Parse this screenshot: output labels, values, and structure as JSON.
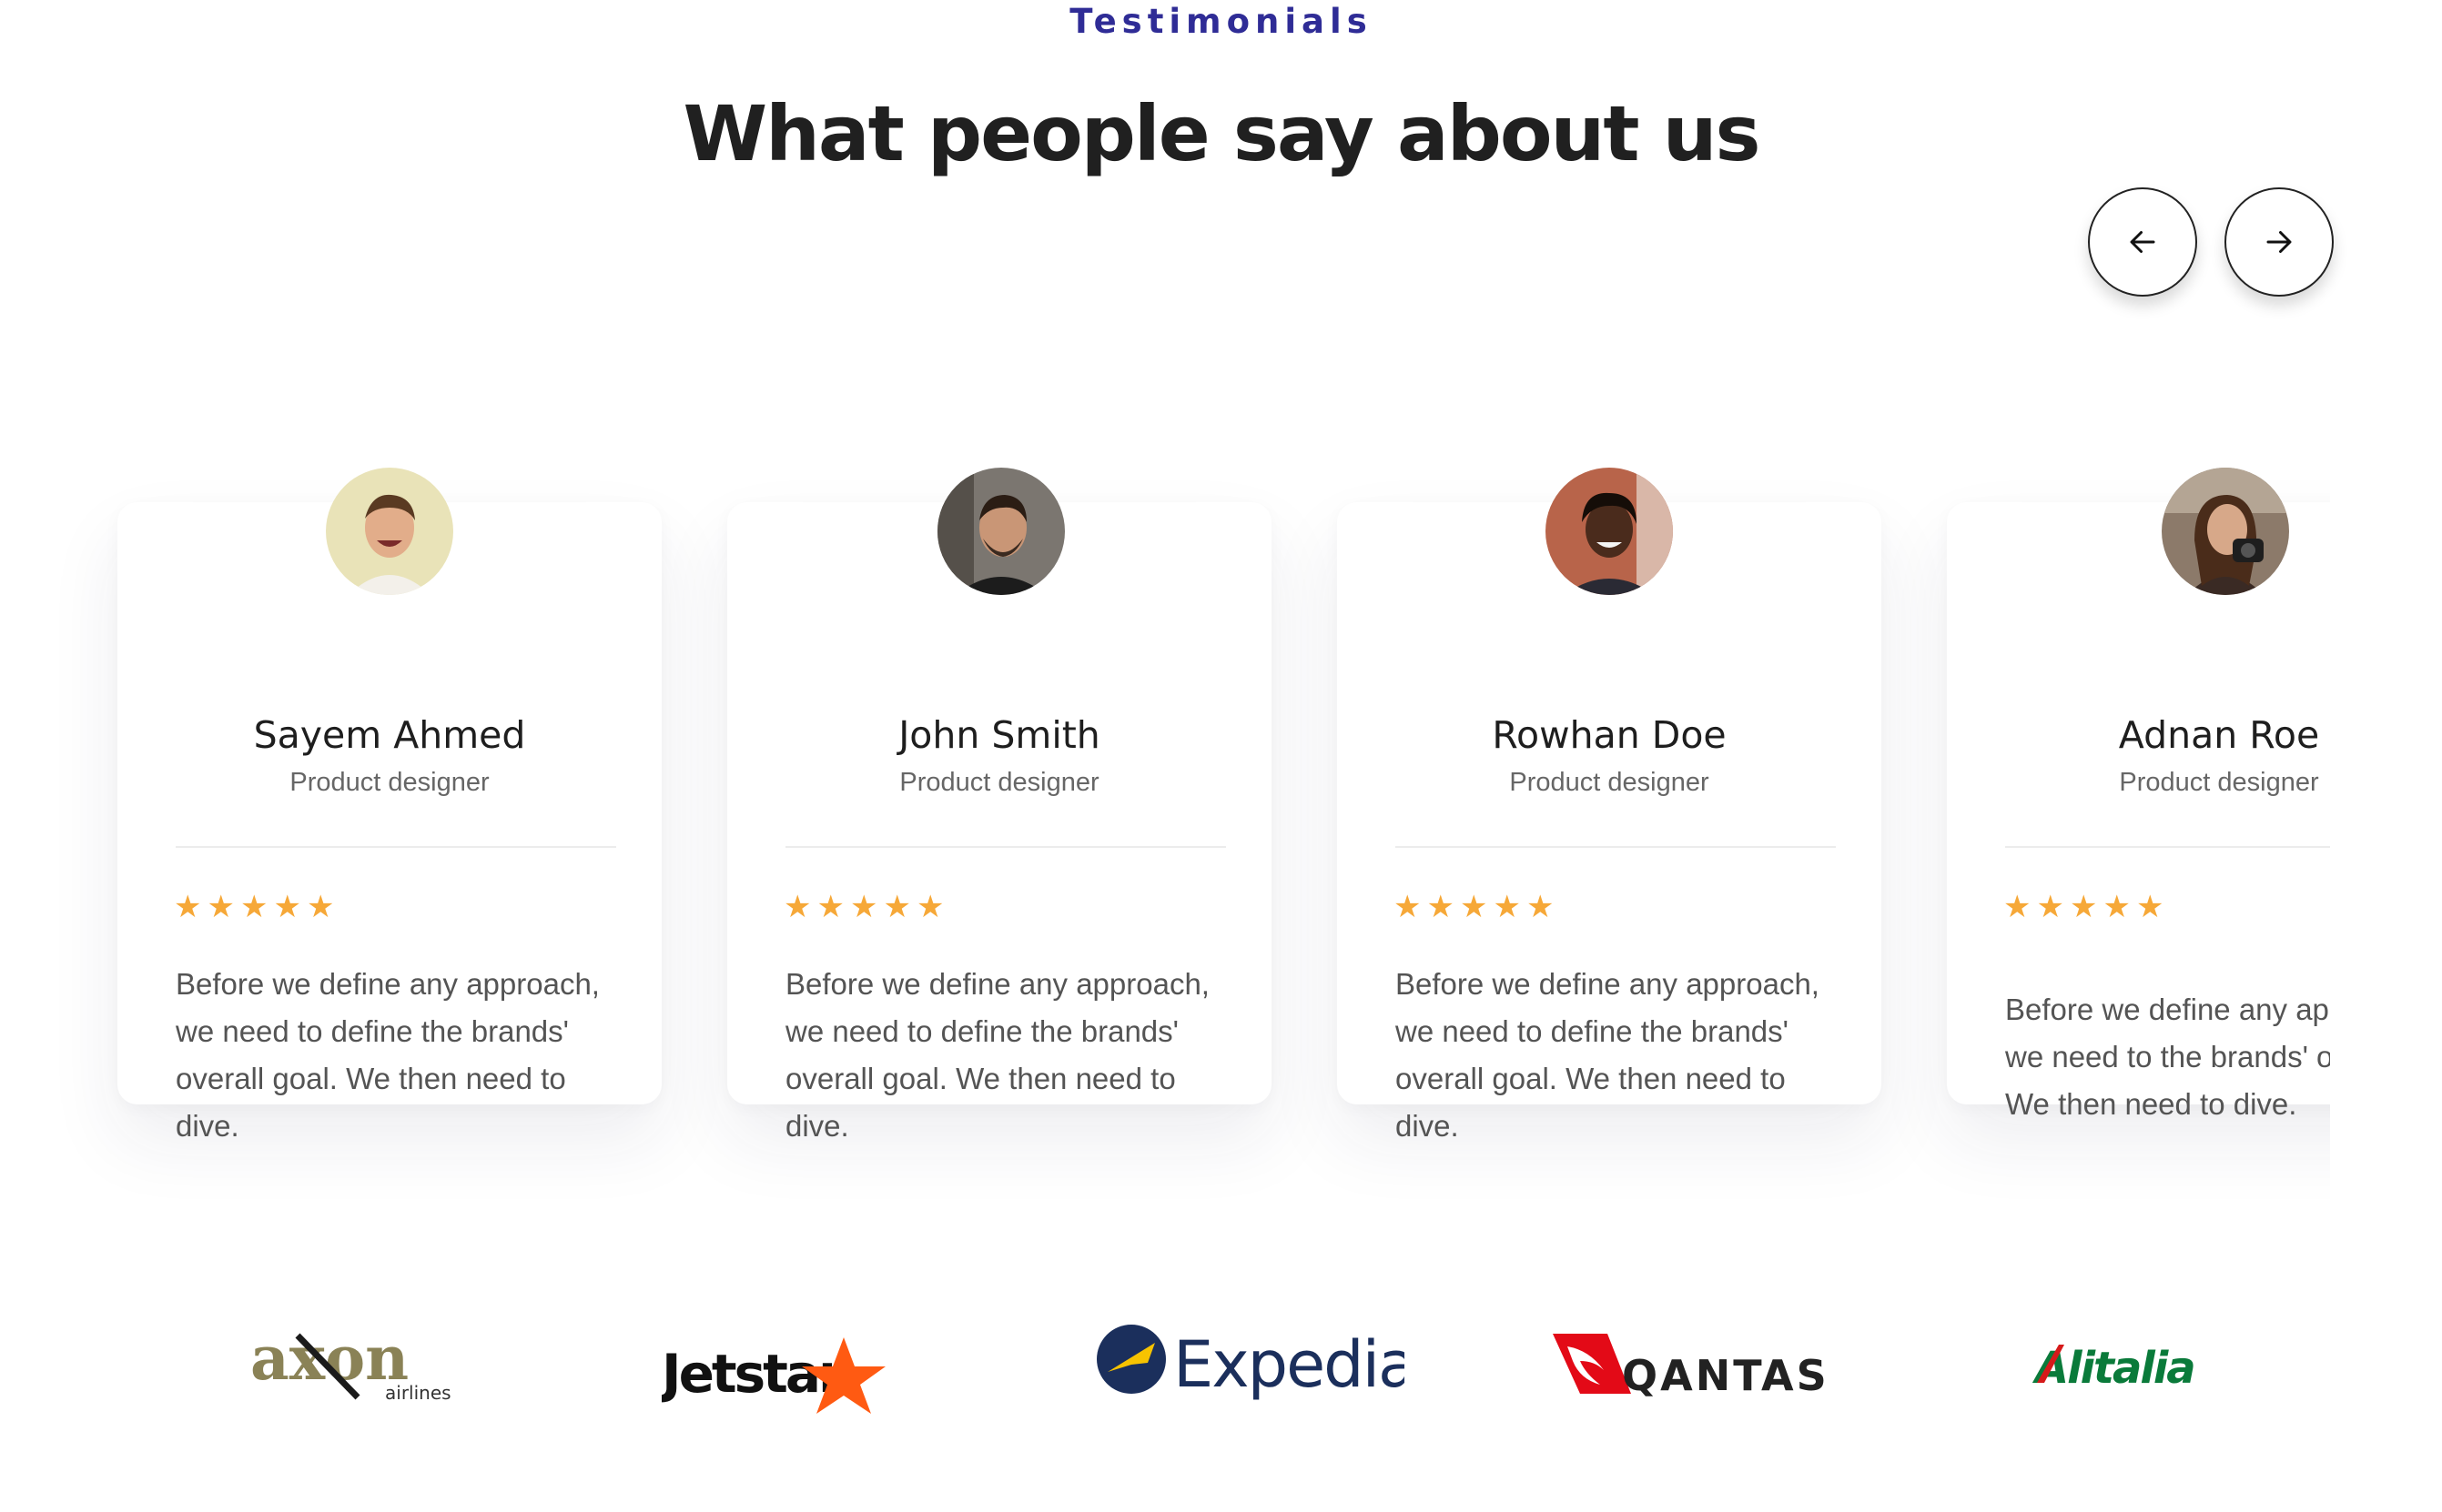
{
  "section": {
    "eyebrow": "Testimonials",
    "title": "What people say about us"
  },
  "navigation": {
    "prev_icon": "arrow-left-icon",
    "next_icon": "arrow-right-icon"
  },
  "testimonials": [
    {
      "name": "Sayem Ahmed",
      "role": "Product designer",
      "rating": 5,
      "quote": "Before we define any approach, we need to define the brands' overall goal. We then need to dive."
    },
    {
      "name": "John Smith",
      "role": "Product designer",
      "rating": 5,
      "quote": "Before we define any approach, we need to define the brands' overall goal. We then need to dive."
    },
    {
      "name": "Rowhan Doe",
      "role": "Product designer",
      "rating": 5,
      "quote": "Before we define any approach, we need to define the brands' overall goal. We then need to dive."
    },
    {
      "name": "Adnan Roe",
      "role": "Product designer",
      "rating": 5,
      "quote": "Before we define any approach, we need to the brands' overall go We then need to dive."
    }
  ],
  "partners": [
    {
      "name": "axon",
      "sub": "airlines",
      "color": "#8a8256"
    },
    {
      "name": "Jetstar",
      "color": "#111111",
      "accent": "#ff5a12"
    },
    {
      "name": "Expedia",
      "color": "#1b2f5c",
      "accent": "#f7c300"
    },
    {
      "name": "QANTAS",
      "color": "#222222",
      "accent": "#e30a17"
    },
    {
      "name": "Alitalia",
      "color": "#0a7a3a",
      "accent": "#d61a1a"
    }
  ],
  "colors": {
    "accent": "#2f2c96",
    "star": "#f6a838",
    "heading": "#202020",
    "text": "#545454"
  }
}
